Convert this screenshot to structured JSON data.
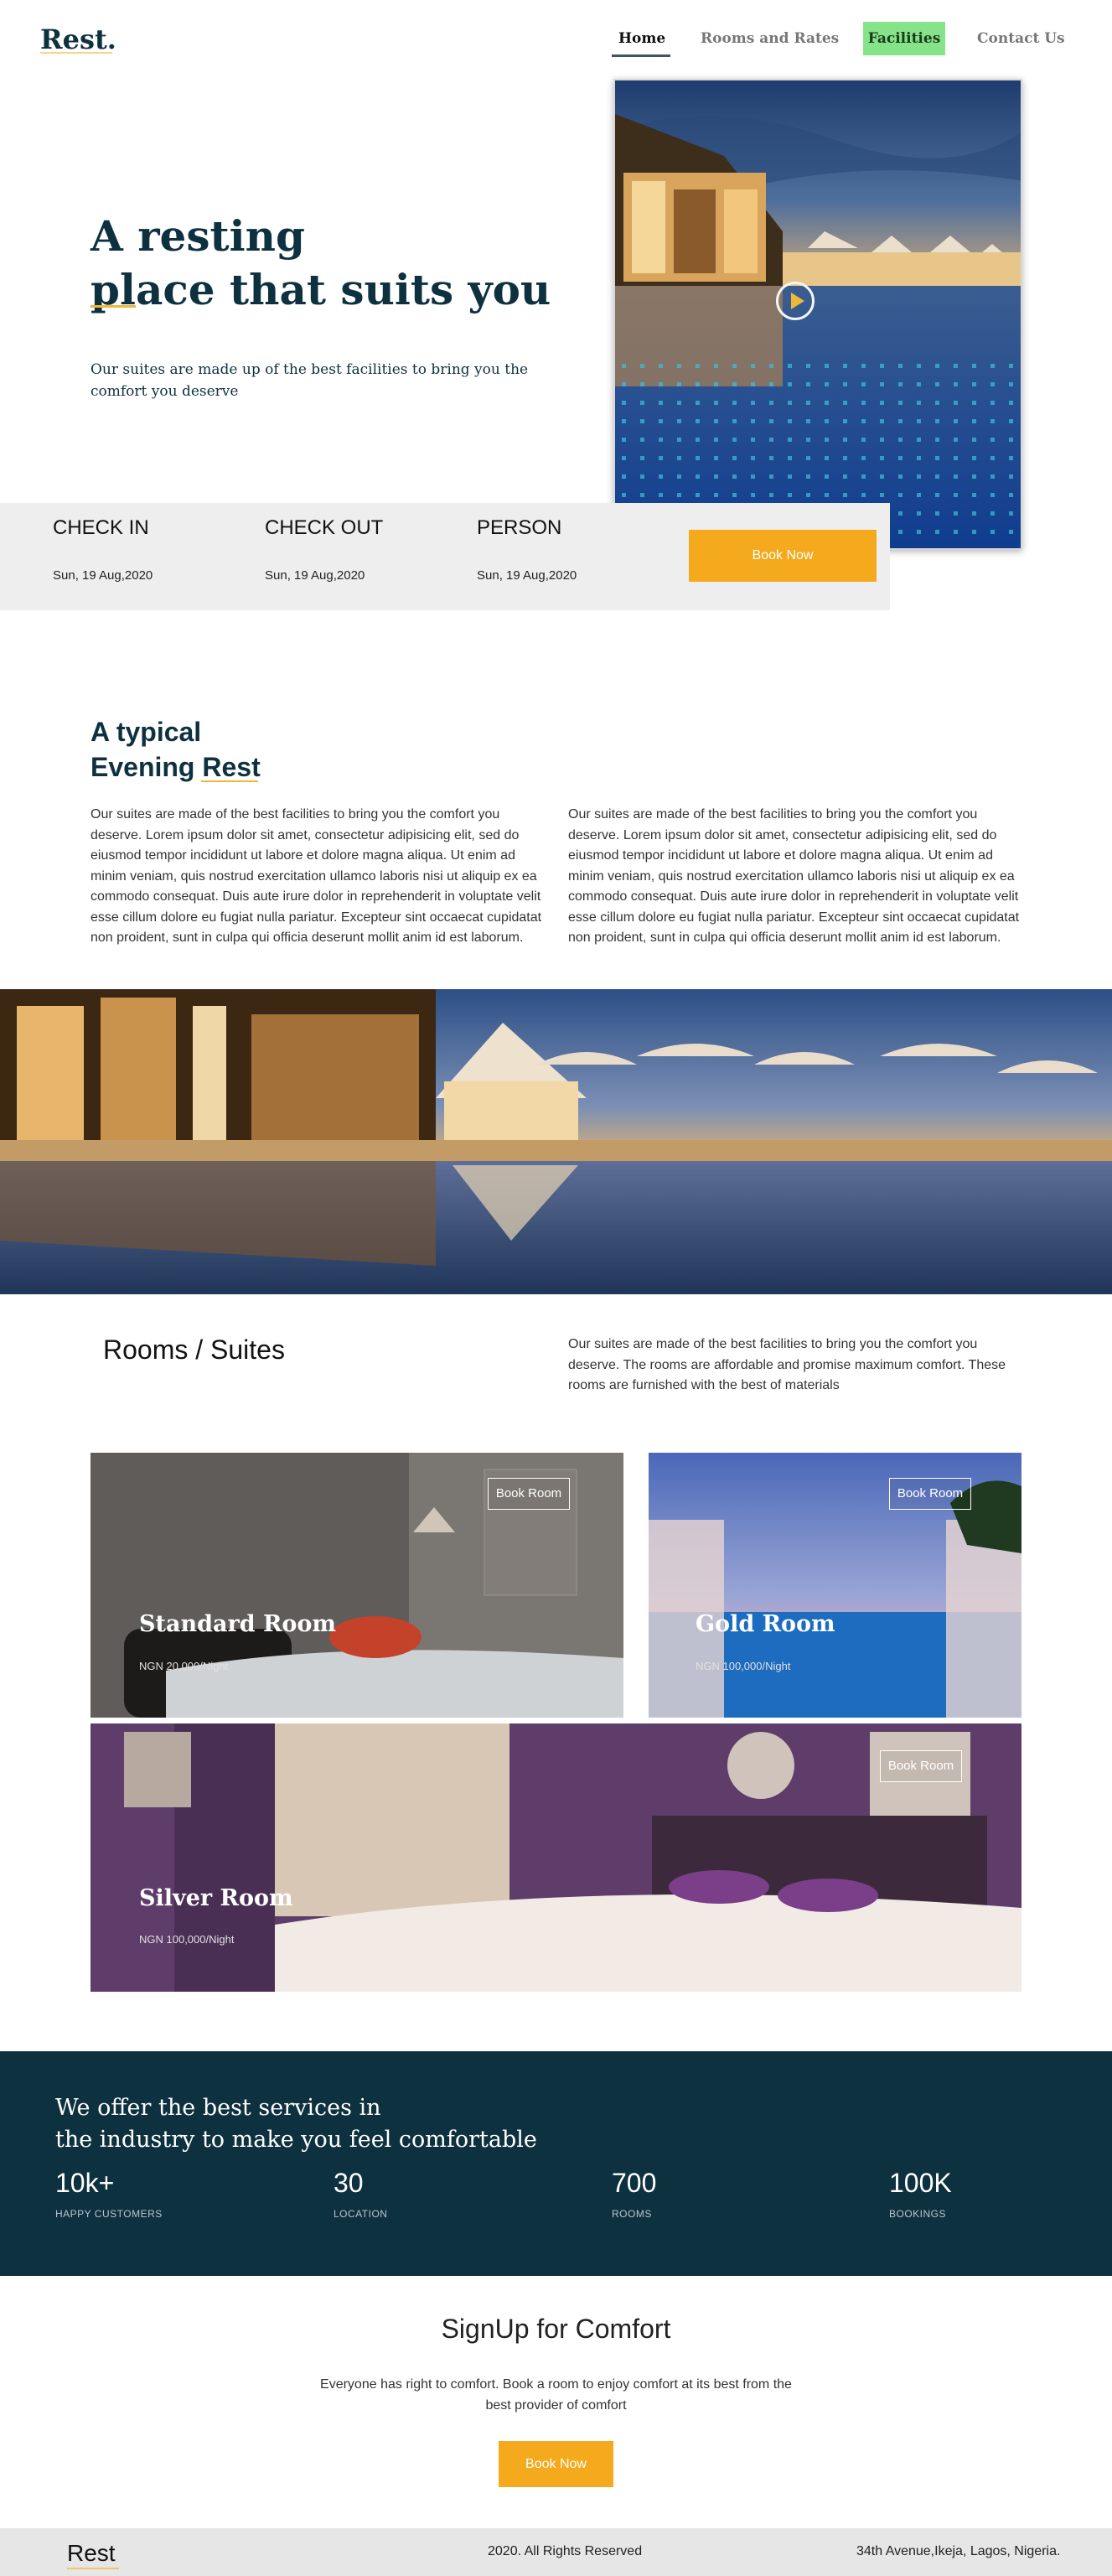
{
  "header": {
    "logo": "Rest.",
    "nav": [
      {
        "label": "Home"
      },
      {
        "label": "Rooms and Rates"
      },
      {
        "label": "Facilities"
      },
      {
        "label": "Contact Us"
      }
    ]
  },
  "hero": {
    "title_line1": "A resting",
    "title_line2": "place that suits you",
    "subtitle": "Our suites are made up of the best facilities to bring you the comfort you deserve",
    "play_icon": "play-icon"
  },
  "booking": {
    "fields": [
      {
        "label": "CHECK IN",
        "value": "Sun, 19 Aug,2020"
      },
      {
        "label": "CHECK OUT",
        "value": "Sun, 19 Aug,2020"
      },
      {
        "label": "PERSON",
        "value": "Sun, 19 Aug,2020"
      }
    ],
    "button": "Book Now"
  },
  "evening": {
    "title_line1": "A typical",
    "title_line2": "Evening Rest",
    "paragraphs": [
      "Our suites are made of the best facilities to bring you the comfort you deserve. Lorem ipsum dolor sit amet, consectetur adipisicing elit, sed do eiusmod tempor incididunt ut labore et dolore magna aliqua. Ut enim ad minim veniam, quis nostrud exercitation ullamco laboris nisi ut aliquip ex ea commodo consequat. Duis aute irure dolor in reprehenderit in voluptate velit esse cillum dolore eu fugiat nulla pariatur. Excepteur sint occaecat cupidatat non proident, sunt in culpa qui officia deserunt mollit anim id est laborum.",
      "Our suites are made of the best facilities to bring you the comfort you deserve. Lorem ipsum dolor sit amet, consectetur adipisicing elit, sed do eiusmod tempor incididunt ut labore et dolore magna aliqua. Ut enim ad minim veniam, quis nostrud exercitation ullamco laboris nisi ut aliquip ex ea commodo consequat. Duis aute irure dolor in reprehenderit in voluptate velit esse cillum dolore eu fugiat nulla pariatur. Excepteur sint occaecat cupidatat non proident, sunt in culpa qui officia deserunt mollit anim id est laborum."
    ]
  },
  "rooms": {
    "title": "Rooms / Suites",
    "description": "Our suites are made of the best facilities to bring you the comfort you deserve. The rooms are affordable and promise maximum comfort. These rooms are furnished with the best of materials",
    "items": [
      {
        "name": "Standard Room",
        "price": "NGN 20,000/Night",
        "button": "Book Room"
      },
      {
        "name": "Gold Room",
        "price": "NGN 100,000/Night",
        "button": "Book Room"
      },
      {
        "name": "Silver Room",
        "price": "NGN 100,000/Night",
        "button": "Book Room"
      }
    ]
  },
  "stats": {
    "title_line1": "We offer the best services in",
    "title_line2": "the industry to make you feel comfortable",
    "items": [
      {
        "value": "10k+",
        "label": "HAPPY CUSTOMERS"
      },
      {
        "value": "30",
        "label": "LOCATION"
      },
      {
        "value": "700",
        "label": "ROOMS"
      },
      {
        "value": "100K",
        "label": "BOOKINGS"
      }
    ]
  },
  "signup": {
    "title": "SignUp for Comfort",
    "text": "Everyone has right to comfort. Book a room to enjoy comfort at its best from the best provider of comfort",
    "button": "Book Now"
  },
  "footer": {
    "logo": "Rest",
    "copyright": "2020. All Rights Reserved",
    "address": "34th Avenue,Ikeja, Lagos, Nigeria."
  },
  "colors": {
    "brand_dark": "#0e3140",
    "accent": "#f5a91d",
    "nav_active_bg": "#86e38a"
  }
}
